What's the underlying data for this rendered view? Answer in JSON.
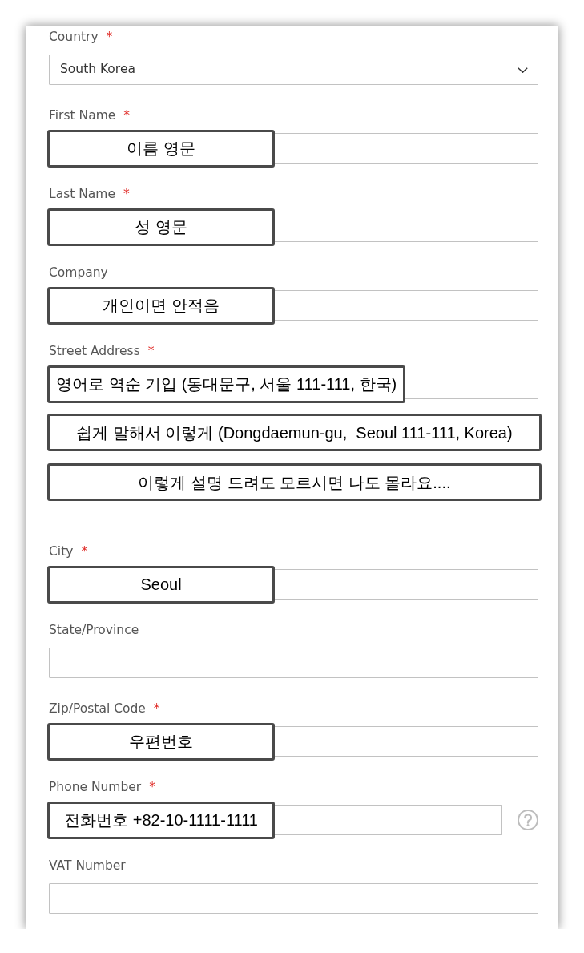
{
  "form": {
    "fields": [
      {
        "label": "Country",
        "required_mark": "*",
        "kind": "select",
        "value": "South Korea"
      },
      {
        "label": "First Name",
        "required_mark": "*",
        "kind": "text",
        "notes": [
          "이름 영문"
        ]
      },
      {
        "label": "Last Name",
        "required_mark": "*",
        "kind": "text",
        "notes": [
          "성 영문"
        ]
      },
      {
        "label": "Company",
        "kind": "text",
        "notes": [
          "개인이면 안적음"
        ]
      },
      {
        "label": "Street Address",
        "required_mark": "*",
        "kind": "text",
        "notes": [
          "영어로 역순 기입 (동대문구, 서울 111-111, 한국)",
          "쉽게 말해서 이렇게 (Dongdaemun-gu,  Seoul 111-111, Korea)",
          "이렇게 설명 드려도 모르시면 나도 몰라요...."
        ]
      },
      {
        "label": "City",
        "required_mark": "*",
        "kind": "text",
        "notes": [
          "Seoul"
        ]
      },
      {
        "label": "State/Province",
        "kind": "text"
      },
      {
        "label": "Zip/Postal Code",
        "required_mark": "*",
        "kind": "text",
        "notes": [
          "우편번호"
        ]
      },
      {
        "label": "Phone Number",
        "required_mark": "*",
        "kind": "text",
        "help": true,
        "notes": [
          "전화번호 +82-10-1111-1111"
        ]
      },
      {
        "label": "VAT Number",
        "kind": "text"
      }
    ]
  }
}
